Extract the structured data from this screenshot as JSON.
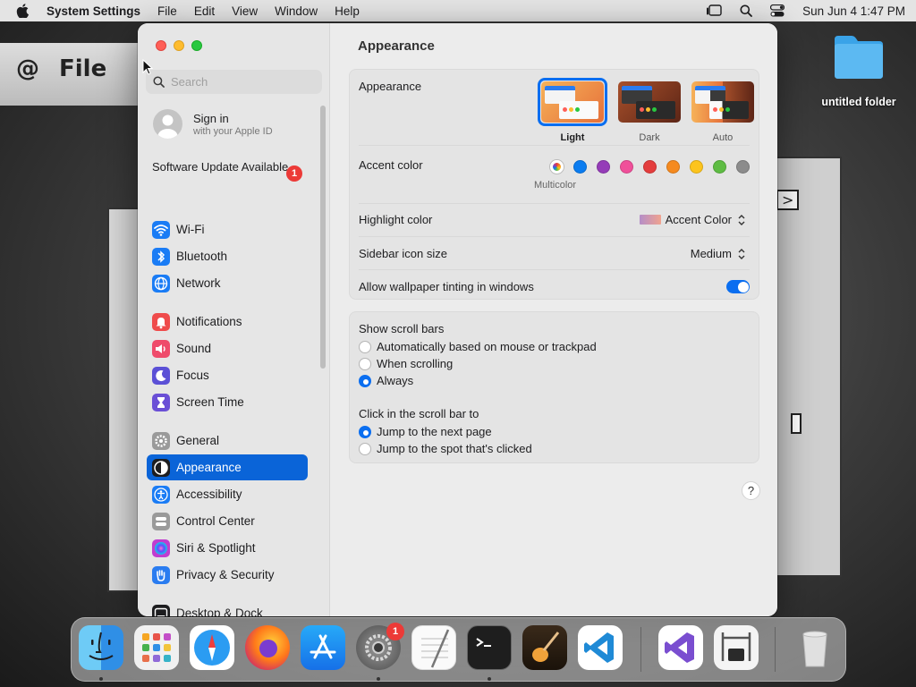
{
  "menubar": {
    "app_name": "System Settings",
    "menus": [
      "File",
      "Edit",
      "View",
      "Window",
      "Help"
    ],
    "clock": "Sun Jun 4  1:47 PM"
  },
  "desktop": {
    "folder_label": "untitled folder",
    "bg_word": "File"
  },
  "sidebar": {
    "search_placeholder": "Search",
    "account": {
      "title": "Sign in",
      "subtitle": "with your Apple ID"
    },
    "software_update": {
      "label": "Software Update Available",
      "badge": "1"
    },
    "items": [
      {
        "label": "Wi-Fi",
        "icon": "wifi-icon",
        "color": "#1a7cf5"
      },
      {
        "label": "Bluetooth",
        "icon": "bluetooth-icon",
        "color": "#1a7cf5"
      },
      {
        "label": "Network",
        "icon": "globe-icon",
        "color": "#1a7cf5"
      },
      {
        "label": "Notifications",
        "icon": "bell-icon",
        "color": "#ef4b4b"
      },
      {
        "label": "Sound",
        "icon": "speaker-icon",
        "color": "#ef4b6b"
      },
      {
        "label": "Focus",
        "icon": "moon-icon",
        "color": "#5b50d6"
      },
      {
        "label": "Screen Time",
        "icon": "hourglass-icon",
        "color": "#6a4fd6"
      },
      {
        "label": "General",
        "icon": "gear-icon",
        "color": "#9a9a9a"
      },
      {
        "label": "Appearance",
        "icon": "appearance-icon",
        "color": "#1d1d1f"
      },
      {
        "label": "Accessibility",
        "icon": "accessibility-icon",
        "color": "#1a7cf5"
      },
      {
        "label": "Control Center",
        "icon": "control-center-icon",
        "color": "#9a9a9a"
      },
      {
        "label": "Siri & Spotlight",
        "icon": "siri-icon",
        "color": "#c03cd0"
      },
      {
        "label": "Privacy & Security",
        "icon": "hand-icon",
        "color": "#2a7cf0"
      },
      {
        "label": "Desktop & Dock",
        "icon": "dock-icon",
        "color": "#1d1d1f"
      }
    ],
    "active": "Appearance"
  },
  "main": {
    "title": "Appearance",
    "appearance": {
      "label": "Appearance",
      "options": [
        "Light",
        "Dark",
        "Auto"
      ],
      "selected": "Light"
    },
    "accent": {
      "label": "Accent color",
      "selected_caption": "Multicolor",
      "colors": [
        "#0a7cf0",
        "#953cb8",
        "#f0509a",
        "#e43d3d",
        "#f58a1f",
        "#fcc41d",
        "#5ebc43",
        "#8c8c8c"
      ]
    },
    "highlight": {
      "label": "Highlight color",
      "value": "Accent Color"
    },
    "icon_size": {
      "label": "Sidebar icon size",
      "value": "Medium"
    },
    "tinting": {
      "label": "Allow wallpaper tinting in windows",
      "enabled": "on"
    },
    "scroll_bars": {
      "label": "Show scroll bars",
      "options": [
        "Automatically based on mouse or trackpad",
        "When scrolling",
        "Always"
      ],
      "selected": "Always"
    },
    "click_scroll": {
      "label": "Click in the scroll bar to",
      "options": [
        "Jump to the next page",
        "Jump to the spot that's clicked"
      ],
      "selected": "Jump to the next page"
    },
    "help": "?"
  },
  "dock": {
    "apps": [
      "Finder",
      "Launchpad",
      "Safari",
      "Firefox",
      "App Store",
      "System Settings",
      "TextEdit",
      "Terminal",
      "GarageBand",
      "Visual Studio Code",
      "Visual Studio",
      "System Information",
      "Trash"
    ],
    "settings_badge": "1"
  }
}
